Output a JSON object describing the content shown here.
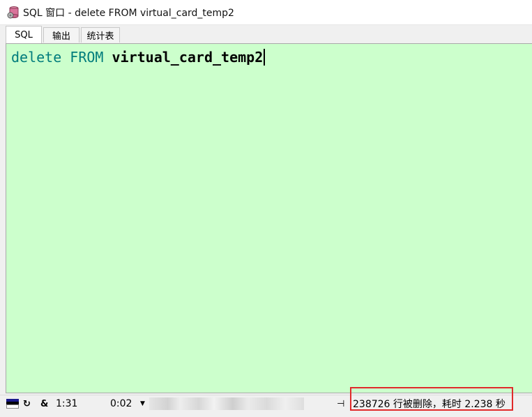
{
  "window": {
    "title": "SQL 窗口 - delete FROM virtual_card_temp2",
    "icon": "sql-window-icon"
  },
  "tabs": [
    {
      "label": "SQL",
      "active": true
    },
    {
      "label": "输出",
      "active": false
    },
    {
      "label": "统计表",
      "active": false
    }
  ],
  "editor": {
    "background": "#ccffcc",
    "keyword_color": "#007c7c",
    "tokens": {
      "kw_delete": "delete",
      "kw_from": "FROM",
      "table": "virtual_card_temp2"
    }
  },
  "statusbar": {
    "icons": [
      "flag-icon",
      "reload-icon",
      "pin-icon"
    ],
    "amp": "&",
    "cursor_pos": "1:31",
    "elapsed": "0:02",
    "message": "238726 行被删除，耗时 2.238 秒",
    "highlight_color": "#e02a2a"
  }
}
